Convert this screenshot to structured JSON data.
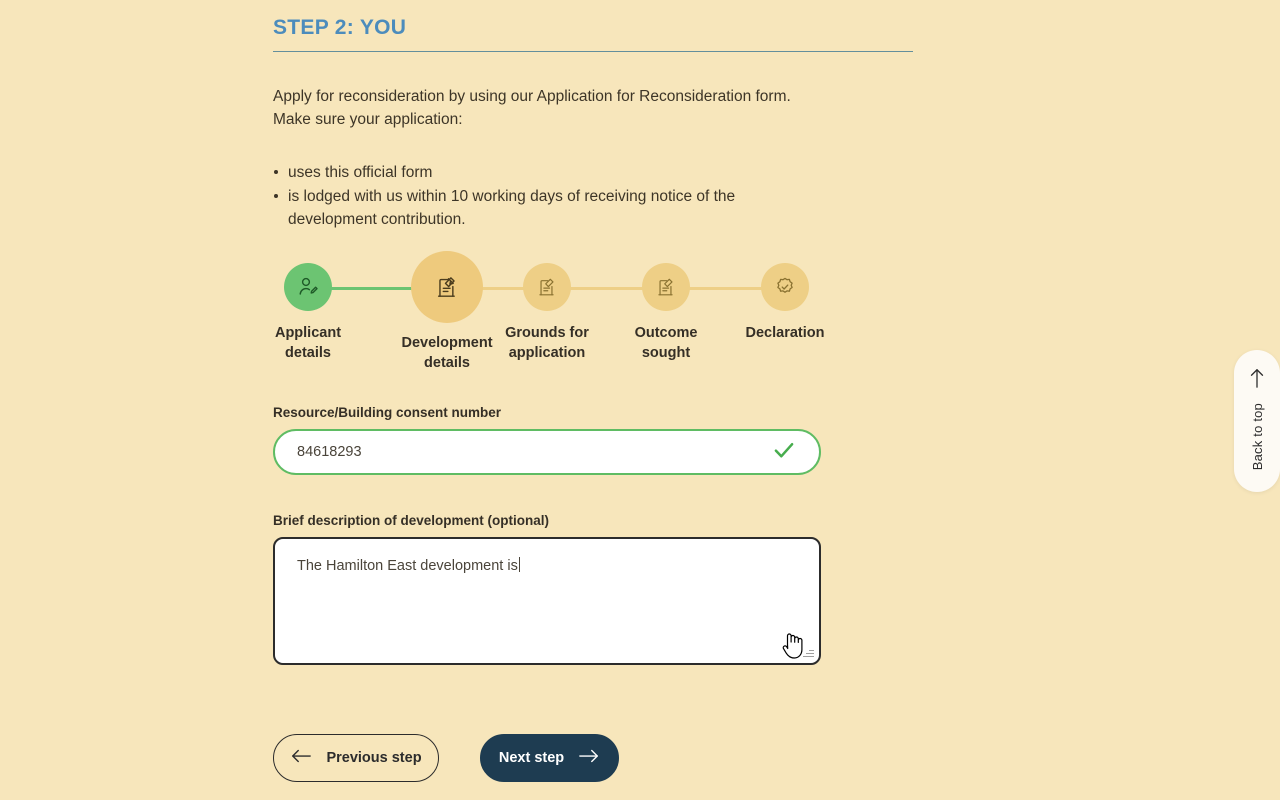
{
  "heading": {
    "title": "STEP 2: YOU"
  },
  "intro": {
    "line1": "Apply for reconsideration by using our Application for Reconsideration form.",
    "line2": "Make sure your application:",
    "bullets": [
      "uses this official form",
      "is lodged with us within 10 working days of receiving notice of the development contribution."
    ]
  },
  "stepper": {
    "steps": [
      {
        "label": "Applicant details",
        "state": "done",
        "icon": "person-edit-icon"
      },
      {
        "label": "Development details",
        "state": "active",
        "icon": "document-edit-icon"
      },
      {
        "label": "Grounds for application",
        "state": "todo",
        "icon": "document-edit-icon"
      },
      {
        "label": "Outcome sought",
        "state": "todo",
        "icon": "document-edit-icon"
      },
      {
        "label": "Declaration",
        "state": "todo",
        "icon": "seal-check-icon"
      }
    ],
    "colors": {
      "done": "#6cc472",
      "active": "#eeca7d",
      "todo": "#eecf86"
    }
  },
  "fields": {
    "consent": {
      "label": "Resource/Building consent number",
      "value": "84618293",
      "placeholder": "",
      "valid_icon": "check-icon",
      "border_color": "#5fbc63"
    },
    "description": {
      "label": "Brief description of development (optional)",
      "value": "The Hamilton East development is",
      "placeholder": "",
      "border_color": "#2c2c2c"
    }
  },
  "buttons": {
    "previous": {
      "label": "Previous step",
      "icon": "arrow-left-icon"
    },
    "next": {
      "label": "Next step",
      "icon": "arrow-right-icon",
      "color": "#1e3c51"
    }
  },
  "back_to_top": {
    "label": "Back to top",
    "icon": "arrow-up-icon"
  },
  "colors": {
    "page_background": "#f7e6bb",
    "heading": "#4c8cbc",
    "text": "#3d3527"
  }
}
